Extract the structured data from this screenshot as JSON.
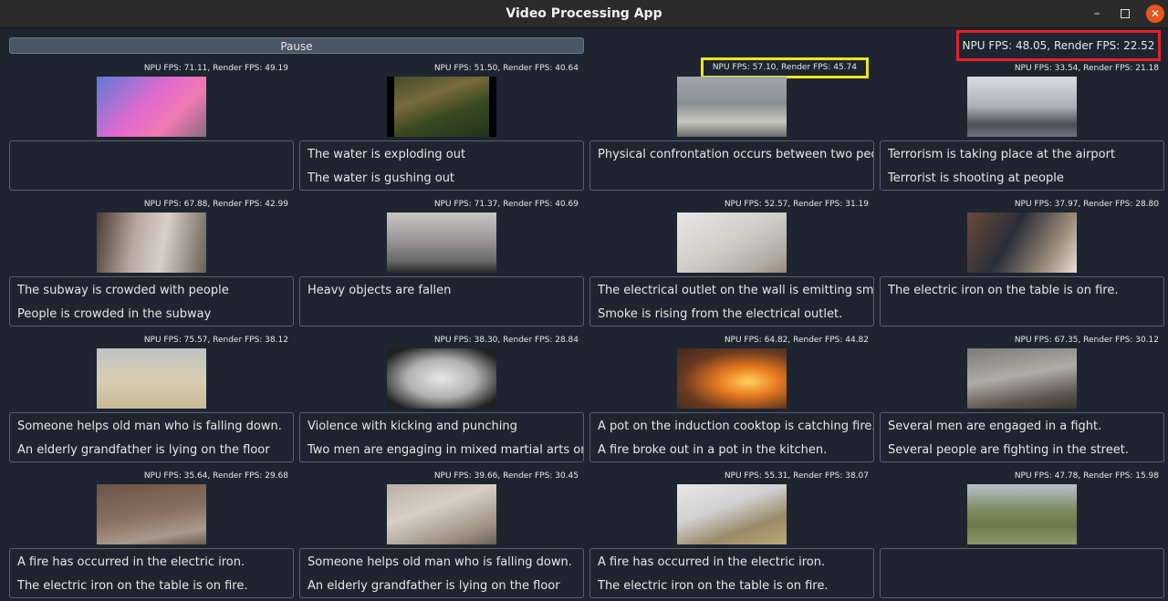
{
  "window": {
    "title": "Video Processing App"
  },
  "controls": {
    "pause_label": "Pause"
  },
  "global_fps": "NPU FPS: 48.05, Render FPS: 22.52",
  "colors": {
    "global_fps_border": "#e8202a",
    "cell_highlight_border": "#f2e51f",
    "close_button": "#e95420"
  },
  "cells": [
    {
      "fps": "NPU FPS: 71.11, Render FPS: 49.19",
      "line1": "",
      "line2": "",
      "thumb": "g-pink"
    },
    {
      "fps": "NPU FPS: 51.50, Render FPS: 40.64",
      "line1": "The water is exploding out",
      "line2": "The water is gushing out",
      "thumb": "g-forest"
    },
    {
      "fps": "NPU FPS: 57.10, Render FPS: 45.74",
      "line1": "Physical confrontation occurs between two people",
      "line2": "",
      "thumb": "g-hall",
      "highlight": true
    },
    {
      "fps": "NPU FPS: 33.54, Render FPS: 21.18",
      "line1": "Terrorism is taking place at the airport",
      "line2": "Terrorist is shooting at people",
      "thumb": "g-airport"
    },
    {
      "fps": "NPU FPS: 67.88, Render FPS: 42.99",
      "line1": "The subway is crowded with people",
      "line2": "People is crowded in the subway",
      "thumb": "g-subway"
    },
    {
      "fps": "NPU FPS: 71.37, Render FPS: 40.69",
      "line1": "Heavy objects are fallen",
      "line2": "",
      "thumb": "g-fall"
    },
    {
      "fps": "NPU FPS: 52.57, Render FPS: 31.19",
      "line1": "The electrical outlet on the wall is emitting smoke",
      "line2": "Smoke is rising from the electrical outlet.",
      "thumb": "g-outlet"
    },
    {
      "fps": "NPU FPS: 37.97, Render FPS: 28.80",
      "line1": "The electric iron on the table is on fire.",
      "line2": "",
      "thumb": "g-kitchen"
    },
    {
      "fps": "NPU FPS: 75.57, Render FPS: 38.12",
      "line1": "Someone helps old man who is falling down.",
      "line2": "An elderly grandfather is lying on the floor",
      "thumb": "g-beach"
    },
    {
      "fps": "NPU FPS: 38.30, Render FPS: 28.84",
      "line1": "Violence with kicking and punching",
      "line2": "Two men are engaging in mixed martial arts on the",
      "thumb": "g-mma"
    },
    {
      "fps": "NPU FPS: 64.82, Render FPS: 44.82",
      "line1": "A pot on the induction cooktop is catching fire.",
      "line2": "A fire broke out in a pot in the kitchen.",
      "thumb": "g-fire"
    },
    {
      "fps": "NPU FPS: 67.35, Render FPS: 30.12",
      "line1": "Several men are engaged in a fight.",
      "line2": "Several people are fighting in the street.",
      "thumb": "g-fight"
    },
    {
      "fps": "NPU FPS: 35.64, Render FPS: 29.68",
      "line1": "A fire has occurred in the electric iron.",
      "line2": "The electric iron on the table is on fire.",
      "thumb": "g-iron"
    },
    {
      "fps": "NPU FPS: 39.66, Render FPS: 30.45",
      "line1": "Someone helps old man who is falling down.",
      "line2": "An elderly grandfather is lying on the floor",
      "thumb": "g-room"
    },
    {
      "fps": "NPU FPS: 55.31, Render FPS: 38.07",
      "line1": "A fire has occurred in the electric iron.",
      "line2": "The electric iron on the table is on fire.",
      "thumb": "g-table"
    },
    {
      "fps": "NPU FPS: 47.78, Render FPS: 15.98",
      "line1": "",
      "line2": "",
      "thumb": "g-park"
    }
  ]
}
